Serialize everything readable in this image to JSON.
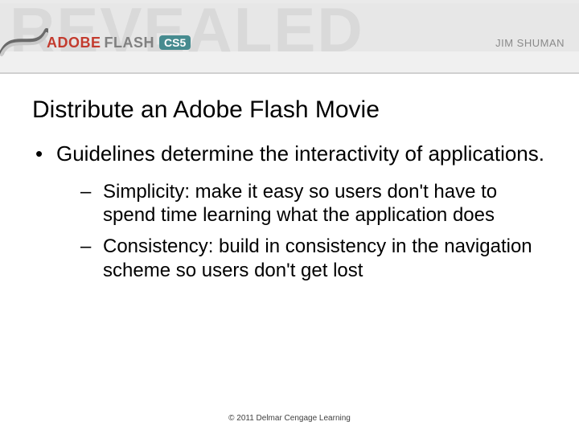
{
  "banner": {
    "revealed_text": "REVEALED",
    "brand_prefix": "ADOBE",
    "brand_product": "FLASH",
    "version_badge": "CS5",
    "author": "JIM SHUMAN"
  },
  "slide": {
    "title": "Distribute an Adobe Flash Movie",
    "bullet_lvl1": "Guidelines determine the interactivity of applications.",
    "sub_bullets": [
      "Simplicity: make it easy so users don't have to spend time learning what the application does",
      "Consistency: build in consistency in the navigation scheme so users don't get lost"
    ]
  },
  "footer": {
    "copyright": "© 2011 Delmar Cengage Learning"
  }
}
